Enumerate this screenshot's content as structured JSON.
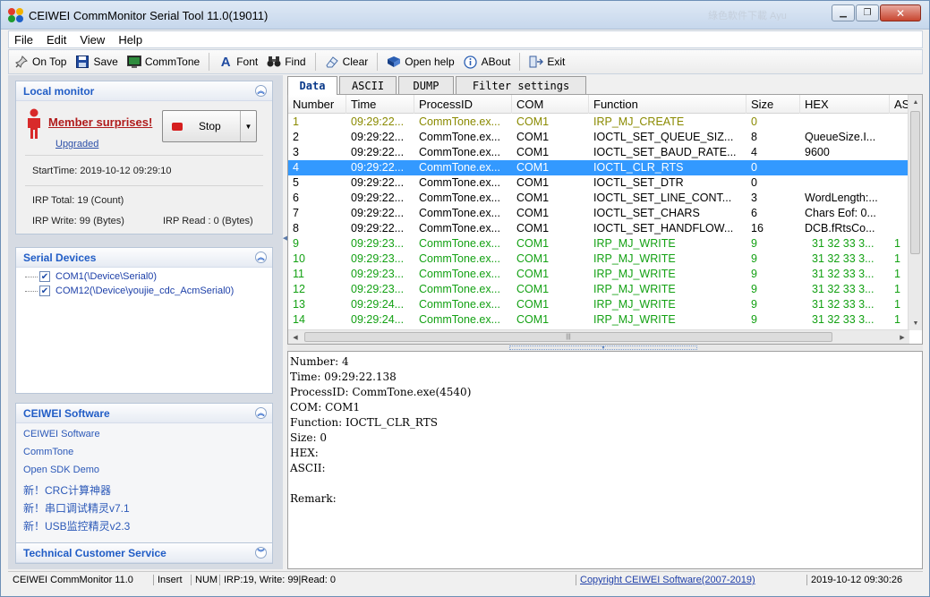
{
  "window": {
    "title": "CEIWEI CommMonitor Serial Tool 11.0(19011)",
    "faded_title": "綠色軟件下載 Ayu"
  },
  "menu": [
    "File",
    "Edit",
    "View",
    "Help"
  ],
  "toolbar": {
    "on_top": "On Top",
    "save": "Save",
    "commtone": "CommTone",
    "font": "Font",
    "find": "Find",
    "clear": "Clear",
    "open_help": "Open help",
    "about": "ABout",
    "exit": "Exit"
  },
  "local_monitor": {
    "title": "Local monitor",
    "member_link": "Member surprises!",
    "upgraded": "Upgraded",
    "stop_label": "Stop",
    "start_time": "StartTime: 2019-10-12 09:29:10",
    "irp_total": "IRP Total: 19 (Count)",
    "irp_write": "IRP Write: 99 (Bytes)",
    "irp_read": "IRP Read : 0 (Bytes)"
  },
  "serial_devices": {
    "title": "Serial Devices",
    "items": [
      "COM1(\\Device\\Serial0)",
      "COM12(\\Device\\youjie_cdc_AcmSerial0)"
    ]
  },
  "ceiwei_software": {
    "title": "CEIWEI Software",
    "links": [
      "CEIWEI Software",
      "CommTone",
      "Open SDK Demo",
      "新！CRC计算神器",
      "新！串口调试精灵v7.1",
      "新！USB监控精灵v2.3"
    ]
  },
  "technical_service": {
    "title": "Technical Customer Service"
  },
  "tabs": [
    "Data",
    "ASCII",
    "DUMP",
    "Filter settings"
  ],
  "table": {
    "columns": [
      "Number",
      "Time",
      "ProcessID",
      "COM",
      "Function",
      "Size",
      "HEX",
      "AS"
    ],
    "rows": [
      {
        "n": "1",
        "time": "09:29:22...",
        "pid": "CommTone.ex...",
        "com": "COM1",
        "func": "IRP_MJ_CREATE",
        "size": "0",
        "hex": "",
        "asc": "",
        "color": "#8a8a00"
      },
      {
        "n": "2",
        "time": "09:29:22...",
        "pid": "CommTone.ex...",
        "com": "COM1",
        "func": "IOCTL_SET_QUEUE_SIZ...",
        "size": "8",
        "hex": "QueueSize.I...",
        "asc": "",
        "color": "#000000"
      },
      {
        "n": "3",
        "time": "09:29:22...",
        "pid": "CommTone.ex...",
        "com": "COM1",
        "func": "IOCTL_SET_BAUD_RATE...",
        "size": "4",
        "hex": "9600",
        "asc": "",
        "color": "#000000"
      },
      {
        "n": "4",
        "time": "09:29:22...",
        "pid": "CommTone.ex...",
        "com": "COM1",
        "func": "IOCTL_CLR_RTS",
        "size": "0",
        "hex": "",
        "asc": "",
        "color": "#ffffff",
        "selected": true
      },
      {
        "n": "5",
        "time": "09:29:22...",
        "pid": "CommTone.ex...",
        "com": "COM1",
        "func": "IOCTL_SET_DTR",
        "size": "0",
        "hex": "",
        "asc": "",
        "color": "#000000"
      },
      {
        "n": "6",
        "time": "09:29:22...",
        "pid": "CommTone.ex...",
        "com": "COM1",
        "func": "IOCTL_SET_LINE_CONT...",
        "size": "3",
        "hex": "WordLength:...",
        "asc": "",
        "color": "#000000"
      },
      {
        "n": "7",
        "time": "09:29:22...",
        "pid": "CommTone.ex...",
        "com": "COM1",
        "func": "IOCTL_SET_CHARS",
        "size": "6",
        "hex": "Chars Eof: 0...",
        "asc": "",
        "color": "#000000"
      },
      {
        "n": "8",
        "time": "09:29:22...",
        "pid": "CommTone.ex...",
        "com": "COM1",
        "func": "IOCTL_SET_HANDFLOW...",
        "size": "16",
        "hex": "DCB.fRtsCo...",
        "asc": "",
        "color": "#000000"
      },
      {
        "n": "9",
        "time": "09:29:23...",
        "pid": "CommTone.ex...",
        "com": "COM1",
        "func": "IRP_MJ_WRITE",
        "size": "9",
        "hex": "31 32 33 3...",
        "asc": "1",
        "color": "#13a113"
      },
      {
        "n": "10",
        "time": "09:29:23...",
        "pid": "CommTone.ex...",
        "com": "COM1",
        "func": "IRP_MJ_WRITE",
        "size": "9",
        "hex": "31 32 33 3...",
        "asc": "1",
        "color": "#13a113"
      },
      {
        "n": "11",
        "time": "09:29:23...",
        "pid": "CommTone.ex...",
        "com": "COM1",
        "func": "IRP_MJ_WRITE",
        "size": "9",
        "hex": "31 32 33 3...",
        "asc": "1",
        "color": "#13a113"
      },
      {
        "n": "12",
        "time": "09:29:23...",
        "pid": "CommTone.ex...",
        "com": "COM1",
        "func": "IRP_MJ_WRITE",
        "size": "9",
        "hex": "31 32 33 3...",
        "asc": "1",
        "color": "#13a113"
      },
      {
        "n": "13",
        "time": "09:29:24...",
        "pid": "CommTone.ex...",
        "com": "COM1",
        "func": "IRP_MJ_WRITE",
        "size": "9",
        "hex": "31 32 33 3...",
        "asc": "1",
        "color": "#13a113"
      },
      {
        "n": "14",
        "time": "09:29:24...",
        "pid": "CommTone.ex...",
        "com": "COM1",
        "func": "IRP_MJ_WRITE",
        "size": "9",
        "hex": "31 32 33 3...",
        "asc": "1",
        "color": "#13a113"
      }
    ]
  },
  "detail": {
    "lines": [
      "Number: 4",
      "Time: 09:29:22.138",
      "ProcessID: CommTone.exe(4540)",
      "COM: COM1",
      "Function: IOCTL_CLR_RTS",
      "Size: 0",
      "HEX:",
      "ASCII:",
      "",
      "Remark:"
    ]
  },
  "status": {
    "app": "CEIWEI CommMonitor 11.0",
    "insert": "Insert",
    "num": "NUM",
    "counts": "IRP:19, Write: 99|Read: 0",
    "copyright": "Copyright CEIWEI Software(2007-2019)",
    "datetime": "2019-10-12 09:30:26"
  },
  "colors": {
    "accent": "#215dc6",
    "selection": "#3399ff",
    "write_green": "#13a113",
    "create_olive": "#8a8a00"
  }
}
